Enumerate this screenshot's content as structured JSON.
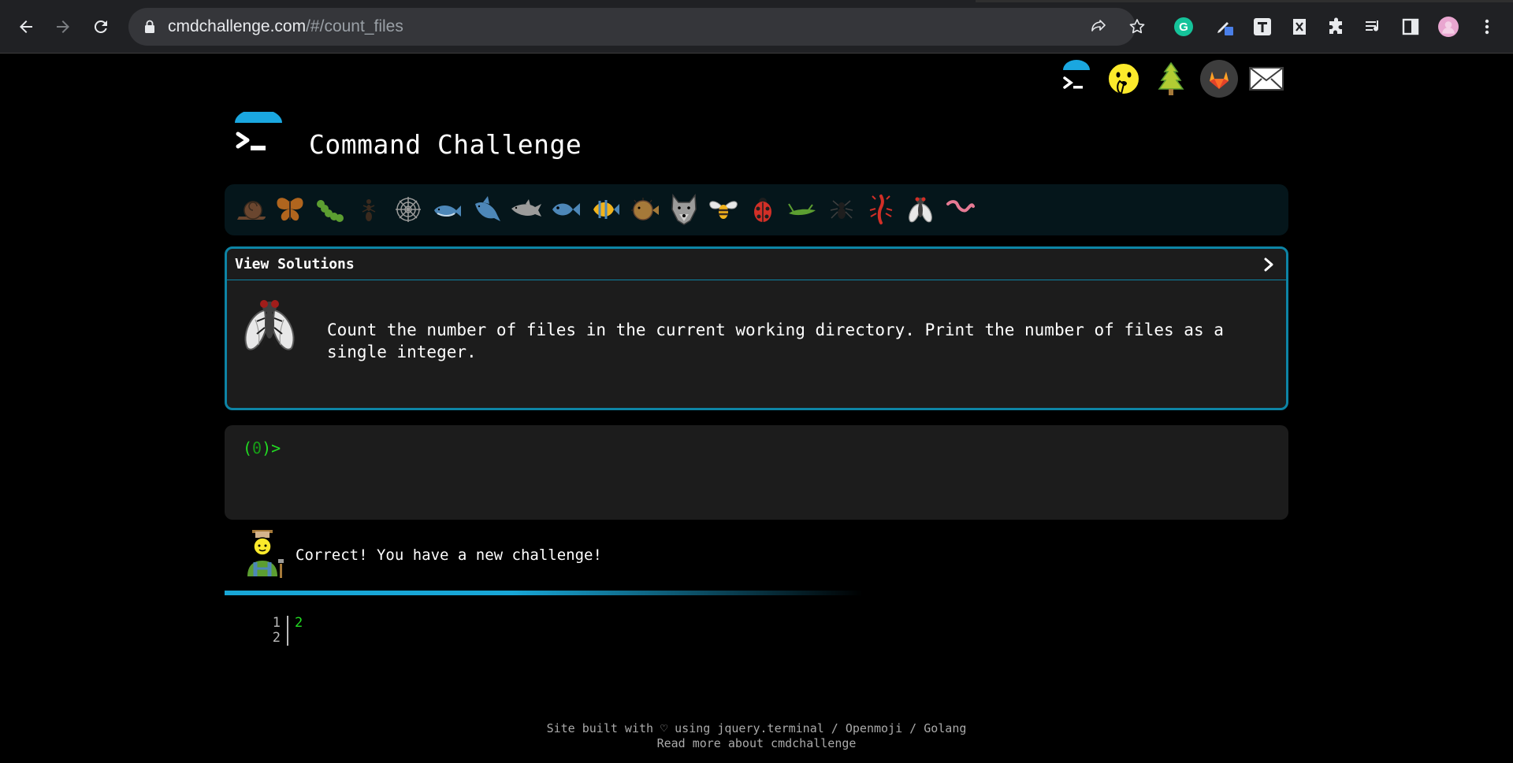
{
  "browser": {
    "url_host": "cmdchallenge.com",
    "url_path": "/#/count_files",
    "extensions": [
      "grammarly-icon",
      "pen-icon",
      "text-t-icon",
      "xcode-icon",
      "puzzle-extensions-icon",
      "media-queue-icon",
      "side-panel-icon",
      "profile-avatar"
    ]
  },
  "header": {
    "title": "Command Challenge",
    "top_icons": [
      "terminal-logo-icon",
      "shushing-face-icon",
      "tree-icon",
      "gitlab-icon",
      "envelope-icon"
    ]
  },
  "critters": [
    "snail",
    "butterfly",
    "caterpillar",
    "ant",
    "spider-web",
    "whale",
    "shark",
    "dolphin",
    "fish",
    "tropical-fish",
    "blowfish",
    "wolf",
    "bee",
    "ladybug",
    "cricket",
    "spider",
    "scorpion",
    "fly",
    "worm"
  ],
  "challenge": {
    "header_label": "View Solutions",
    "description": "Count the number of files in the current working directory. Print the number of files as a single integer."
  },
  "terminal": {
    "prompt_open": "(",
    "prompt_num": "0",
    "prompt_close": ")>"
  },
  "result": {
    "message": "Correct! You have a new challenge!",
    "progress_fraction": 0.55
  },
  "output": {
    "line_numbers": [
      "1",
      "2"
    ],
    "value": "2"
  },
  "footer": {
    "line1": "Site built with ♡ using jquery.terminal / Openmoji / Golang",
    "line2": "Read more about cmdchallenge"
  },
  "colors": {
    "accent": "#0d84a5",
    "prompt_green": "#22dd22",
    "progress": "#18a6d6"
  }
}
